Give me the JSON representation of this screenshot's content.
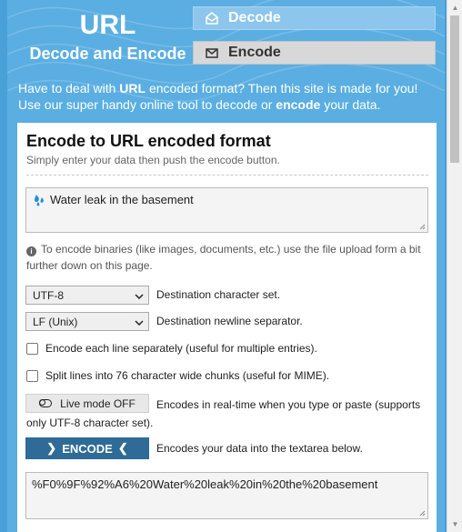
{
  "header": {
    "logo_title": "URL",
    "logo_subtitle": "Decode and Encode",
    "nav": {
      "decode_label": "Decode",
      "encode_label": "Encode"
    }
  },
  "intro": {
    "part1": "Have to deal with ",
    "bold1": "URL",
    "part2": " encoded format? Then this site is made for you! Use our super handy online tool to decode or ",
    "bold2": "encode",
    "part3": " your data."
  },
  "card": {
    "title": "Encode to URL encoded format",
    "subtitle": "Simply enter your data then push the encode button.",
    "input_value": "Water leak in the basement",
    "binary_note": "To encode binaries (like images, documents, etc.) use the file upload form a bit further down on this page.",
    "charset": {
      "value": "UTF-8",
      "label": "Destination character set."
    },
    "newline": {
      "value": "LF (Unix)",
      "label": "Destination newline separator."
    },
    "check_each_line": "Encode each line separately (useful for multiple entries).",
    "check_split": "Split lines into 76 character wide chunks (useful for MIME).",
    "live_mode_label": "Live mode OFF",
    "live_mode_desc": "Encodes in real-time when you type or paste (supports only UTF-8 character set).",
    "encode_button_label": "ENCODE",
    "encode_desc": "Encodes your data into the textarea below.",
    "output_value": "%F0%9F%92%A6%20Water%20leak%20in%20the%20basement"
  },
  "colors": {
    "background": "#5aaee2",
    "encode_button": "#2e6b96",
    "nav_decode": "#8dc6ec",
    "nav_encode": "#d8d8d8"
  },
  "icons": {
    "decode": "envelope-open-icon",
    "encode": "envelope-icon",
    "emoji": "droplets-emoji-icon",
    "info": "info-icon",
    "toggle": "toggle-off-icon"
  }
}
